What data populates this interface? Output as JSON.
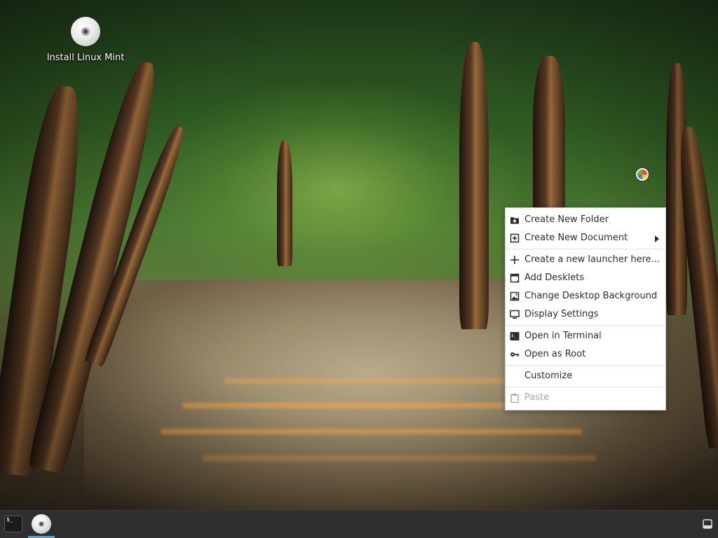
{
  "desktop": {
    "icons": [
      {
        "label": "Install Linux Mint",
        "icon": "disc-icon"
      }
    ]
  },
  "context_menu": {
    "items": [
      {
        "label": "Create New Folder",
        "icon": "folder-plus-icon",
        "enabled": true
      },
      {
        "label": "Create New Document",
        "icon": "document-plus-icon",
        "enabled": true,
        "submenu": true
      },
      {
        "label": "Create a new launcher here...",
        "icon": "plus-icon",
        "enabled": true
      },
      {
        "label": "Add Desklets",
        "icon": "desklet-icon",
        "enabled": true
      },
      {
        "label": "Change Desktop Background",
        "icon": "image-icon",
        "enabled": true
      },
      {
        "label": "Display Settings",
        "icon": "monitor-icon",
        "enabled": true
      },
      {
        "label": "Open in Terminal",
        "icon": "terminal-icon",
        "enabled": true
      },
      {
        "label": "Open as Root",
        "icon": "key-icon",
        "enabled": true
      },
      {
        "label": "Customize",
        "icon": "",
        "enabled": true
      },
      {
        "label": "Paste",
        "icon": "clipboard-icon",
        "enabled": false
      }
    ]
  },
  "taskbar": {
    "terminal_prompt": "$_",
    "items": [
      {
        "name": "terminal-launcher",
        "icon": "terminal-icon"
      },
      {
        "name": "install-linux-mint-window",
        "icon": "disc-icon",
        "active": true
      }
    ],
    "show_desktop_icon": "show-desktop-icon"
  },
  "colors": {
    "taskbar_bg": "#2f2f2f",
    "active_indicator": "#4aa3df",
    "menu_bg": "#ffffff",
    "menu_text": "#2b2b2b",
    "menu_disabled_text": "#a8a8a8"
  }
}
